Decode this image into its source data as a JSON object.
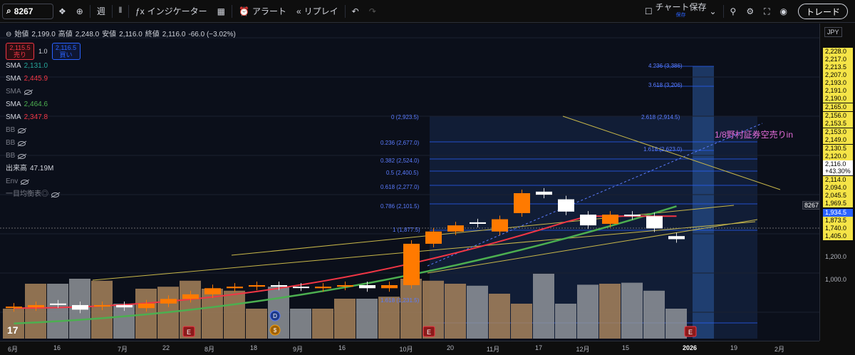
{
  "toolbar": {
    "symbol": "8267",
    "interval": "週",
    "indicators": "インジケーター",
    "alert": "アラート",
    "replay": "リプレイ",
    "save": "チャート保存",
    "save_sub": "保存",
    "trade": "トレード"
  },
  "legend": {
    "open_label": "始値",
    "open": "2,199.0",
    "high_label": "高値",
    "high": "2,248.0",
    "low_label": "安値",
    "low": "2,116.0",
    "close_label": "終値",
    "close": "2,116.0",
    "change": "-66.0 (−3.02%)",
    "sell_price": "2,115.5",
    "sell_label": "売り",
    "spread": "1.0",
    "buy_price": "2,116.5",
    "buy_label": "買い",
    "indicators": [
      {
        "name": "SMA",
        "value": "2,131.0",
        "color": "#26a69a",
        "hidden": false
      },
      {
        "name": "SMA",
        "value": "2,445.9",
        "color": "#f23645",
        "hidden": false
      },
      {
        "name": "SMA",
        "value": "",
        "color": "#787b86",
        "hidden": true
      },
      {
        "name": "SMA",
        "value": "2,464.6",
        "color": "#4caf50",
        "hidden": false
      },
      {
        "name": "SMA",
        "value": "2,347.8",
        "color": "#f23645",
        "hidden": false
      },
      {
        "name": "BB",
        "value": "",
        "color": "#787b86",
        "hidden": true
      },
      {
        "name": "BB",
        "value": "",
        "color": "#787b86",
        "hidden": true
      },
      {
        "name": "BB",
        "value": "",
        "color": "#787b86",
        "hidden": true
      },
      {
        "name": "出来高",
        "value": "47.19M",
        "color": "#d1d4dc",
        "hidden": false
      },
      {
        "name": "Env",
        "value": "",
        "color": "#787b86",
        "hidden": true
      },
      {
        "name": "一目均衡表◎",
        "value": "",
        "color": "#787b86",
        "hidden": true
      }
    ]
  },
  "currency": "JPY",
  "price_axis": [
    "2,228.0",
    "2,217.0",
    "2,213.5",
    "2,207.0",
    "2,193.0",
    "2,191.0",
    "2,190.0",
    "2,165.0",
    "2,156.0",
    "2,153.5",
    "2,153.0",
    "2,149.0",
    "2,130.5",
    "2,120.0",
    "2,116.0",
    "+43.30%",
    "2,114.0",
    "2,094.0",
    "2,045.5",
    "1,969.5",
    "1,934.5",
    "1,873.5",
    "1,740.0",
    "1,405.0",
    "1,200.0",
    "1,000.0"
  ],
  "time_axis": [
    "6月",
    "16",
    "7月",
    "22",
    "8月",
    "18",
    "9月",
    "16",
    "10月",
    "20",
    "11月",
    "17",
    "12月",
    "15",
    "2026",
    "19",
    "2月"
  ],
  "fib_labels": [
    "4.236 (3,386)",
    "3.618 (3,206)",
    "2.618 (2,914.5)",
    "1.618 (2,623.0)",
    "0 (2,923.5)",
    "0.236 (2,677.0)",
    "0.382 (2,524.0)",
    "0.5 (2,400.5)",
    "0.618 (2,277.0)",
    "0.786 (2,101.5)",
    "1 (1,877.5)",
    "1.618 (1,231.5)"
  ],
  "annotation": "1/8野村証券空売りin",
  "current_label": "8267",
  "badges": [
    "D",
    "$"
  ],
  "earnings_marker": "E",
  "colors": {
    "up": "#ff7a00",
    "down": "#ffffff",
    "sma_fast": "#f23645",
    "sma_slow": "#4caf50",
    "fib": "#2962ff",
    "axis_highlight": "#f5e447"
  },
  "chart_data": {
    "type": "candlestick",
    "note": "weekly OHLC approx",
    "series": [
      {
        "o": 1000,
        "c": 1010
      },
      {
        "o": 1005,
        "c": 1020
      },
      {
        "o": 1030,
        "c": 1025
      },
      {
        "o": 1020,
        "c": 990
      },
      {
        "o": 1010,
        "c": 1020
      },
      {
        "o": 1020,
        "c": 1005
      },
      {
        "o": 1000,
        "c": 1030
      },
      {
        "o": 1030,
        "c": 1060
      },
      {
        "o": 1060,
        "c": 1090
      },
      {
        "o": 1090,
        "c": 1130
      },
      {
        "o": 1130,
        "c": 1140
      },
      {
        "o": 1140,
        "c": 1150
      },
      {
        "o": 1150,
        "c": 1140
      },
      {
        "o": 1140,
        "c": 1135
      },
      {
        "o": 1130,
        "c": 1140
      },
      {
        "o": 1140,
        "c": 1150
      },
      {
        "o": 1150,
        "c": 1130
      },
      {
        "o": 1130,
        "c": 1150
      },
      {
        "o": 1150,
        "c": 1420
      },
      {
        "o": 1420,
        "c": 1500
      },
      {
        "o": 1500,
        "c": 1540
      },
      {
        "o": 1560,
        "c": 1550
      },
      {
        "o": 1500,
        "c": 1580
      },
      {
        "o": 1620,
        "c": 1750
      },
      {
        "o": 1760,
        "c": 1740
      },
      {
        "o": 1710,
        "c": 1630
      },
      {
        "o": 1610,
        "c": 1540
      },
      {
        "o": 1550,
        "c": 1610
      },
      {
        "o": 1610,
        "c": 1600
      },
      {
        "o": 1600,
        "c": 1520
      },
      {
        "o": 1470,
        "c": 1450
      }
    ],
    "volume": [
      30,
      55,
      55,
      60,
      58,
      35,
      50,
      52,
      58,
      50,
      48,
      30,
      52,
      30,
      30,
      40,
      40,
      42,
      60,
      58,
      55,
      53,
      45,
      35,
      65,
      35,
      54,
      55,
      56,
      48,
      30
    ]
  }
}
